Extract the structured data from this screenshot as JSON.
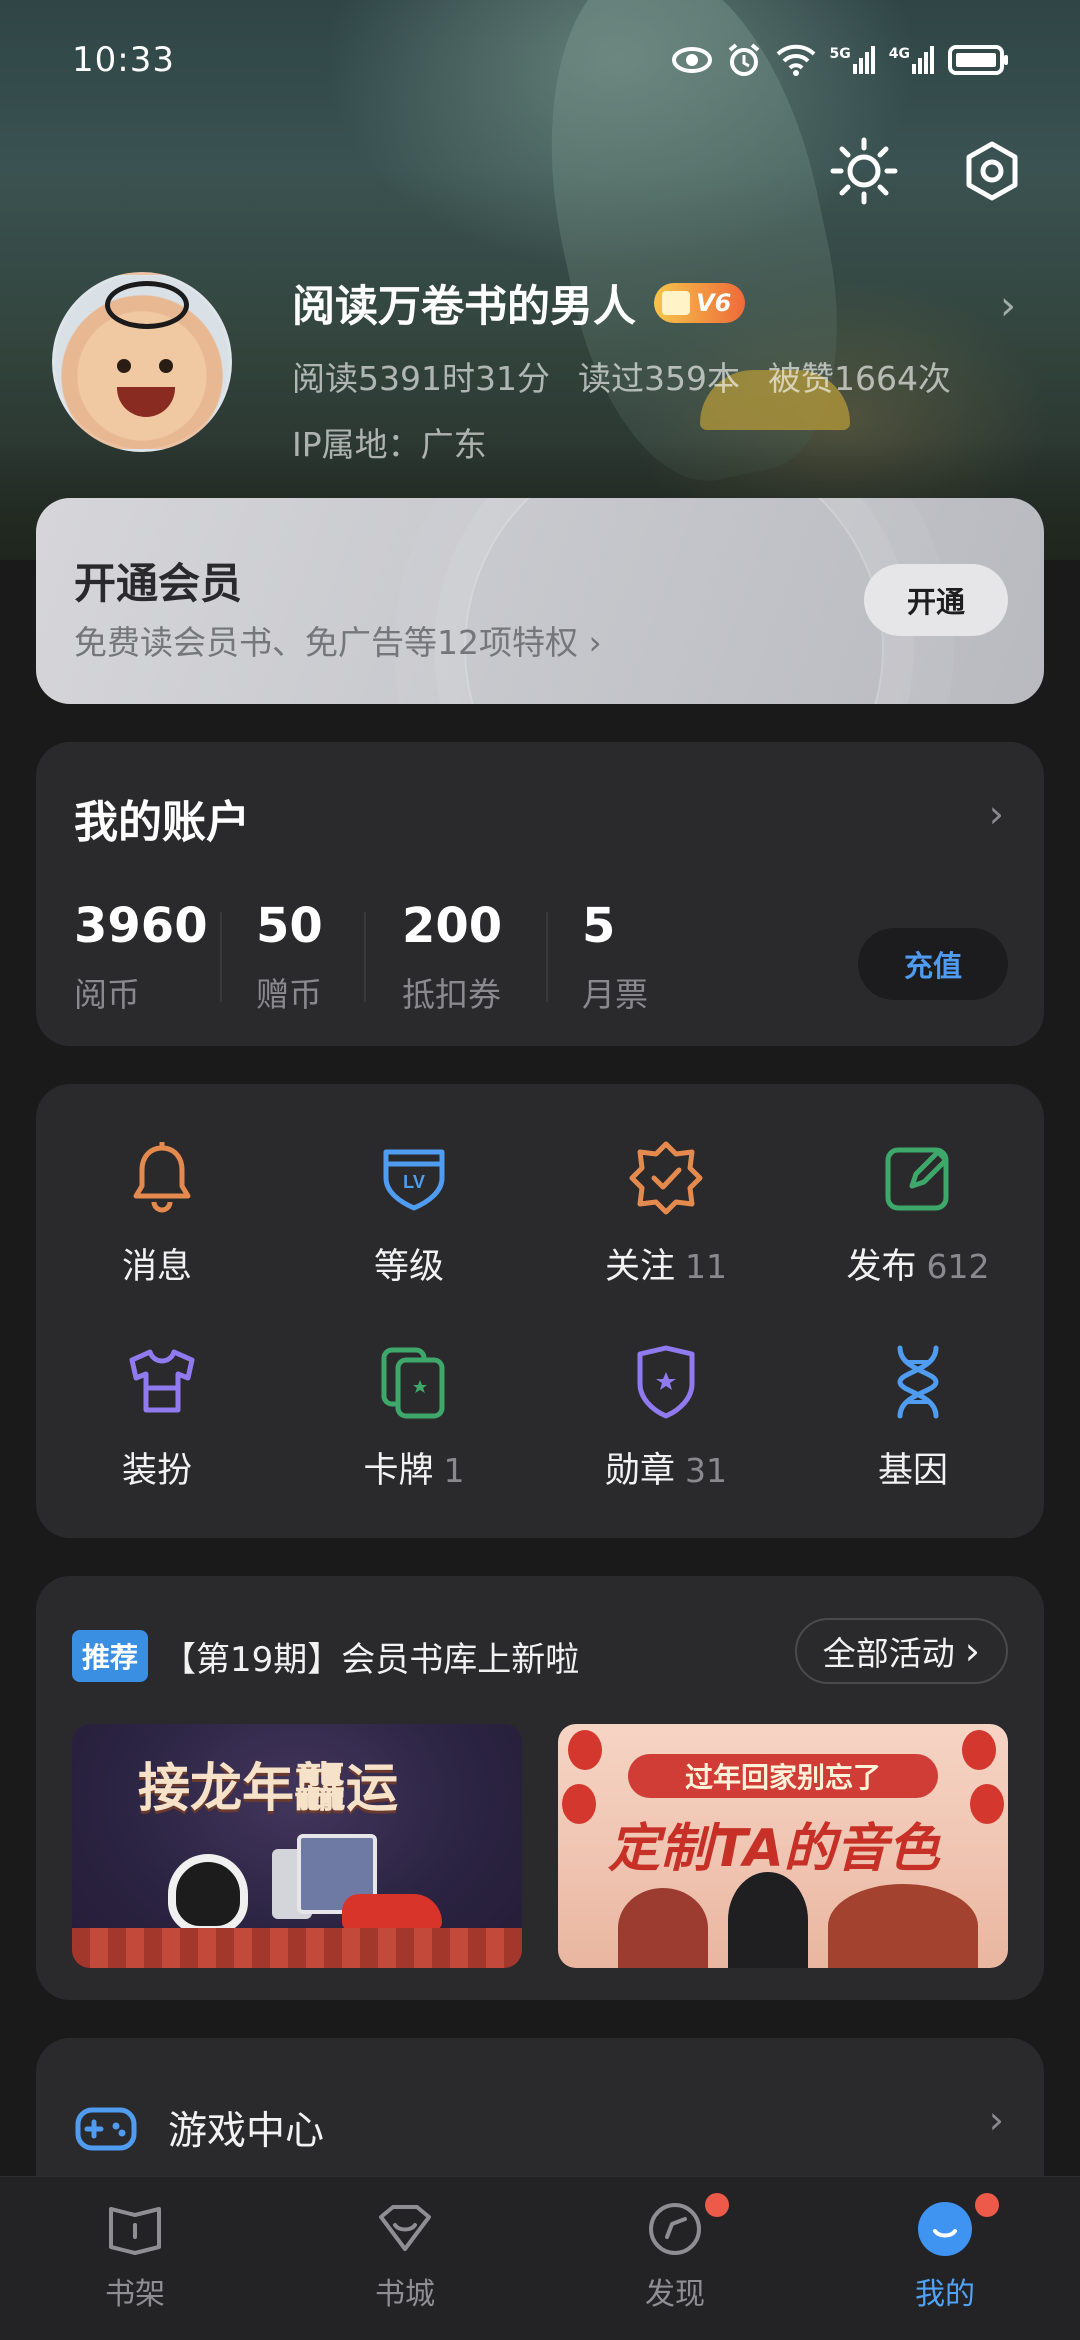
{
  "status_bar": {
    "time": "10:33",
    "signal1": "5G",
    "signal2": "4G"
  },
  "profile": {
    "username": "阅读万卷书的男人",
    "vip_level": "V6",
    "read_time": "阅读5391时31分",
    "books_read": "读过359本",
    "likes": "被赞1664次",
    "ip_location": "IP属地：广东"
  },
  "member": {
    "title": "开通会员",
    "subtitle": "免费读会员书、免广告等12项特权 ›",
    "button": "开通"
  },
  "account": {
    "title": "我的账户",
    "items": [
      {
        "value": "3960",
        "label": "阅币"
      },
      {
        "value": "50",
        "label": "赠币"
      },
      {
        "value": "200",
        "label": "抵扣券"
      },
      {
        "value": "5",
        "label": "月票"
      }
    ],
    "recharge": "充值"
  },
  "grid": [
    {
      "label": "消息",
      "count": "",
      "icon": "bell-icon",
      "color": "#e58a4e"
    },
    {
      "label": "等级",
      "count": "",
      "icon": "level-icon",
      "color": "#4f9cf0"
    },
    {
      "label": "关注",
      "count": "11",
      "icon": "badge-check-icon",
      "color": "#e58a4e"
    },
    {
      "label": "发布",
      "count": "612",
      "icon": "edit-icon",
      "color": "#3ea86a"
    },
    {
      "label": "装扮",
      "count": "",
      "icon": "shirt-icon",
      "color": "#8f7af0"
    },
    {
      "label": "卡牌",
      "count": "1",
      "icon": "cards-icon",
      "color": "#3ea86a"
    },
    {
      "label": "勋章",
      "count": "31",
      "icon": "medal-icon",
      "color": "#8f7af0"
    },
    {
      "label": "基因",
      "count": "",
      "icon": "dna-icon",
      "color": "#4f9cf0"
    }
  ],
  "promo": {
    "tag": "推荐",
    "title": "【第19期】会员书库上新啦",
    "all_activities": "全部活动",
    "banner_left_text": "接龙年龘运",
    "banner_right_line1": "过年回家别忘了",
    "banner_right_line2": "定制TA的音色"
  },
  "game_center": {
    "label": "游戏中心"
  },
  "bottom_nav": [
    {
      "label": "书架",
      "active": false,
      "dot": false
    },
    {
      "label": "书城",
      "active": false,
      "dot": false
    },
    {
      "label": "发现",
      "active": false,
      "dot": true
    },
    {
      "label": "我的",
      "active": true,
      "dot": true
    }
  ],
  "colors": {
    "accent": "#4fa2f5",
    "vip_gradient_start": "#f5c64a",
    "notification_dot": "#ee5a4a"
  }
}
